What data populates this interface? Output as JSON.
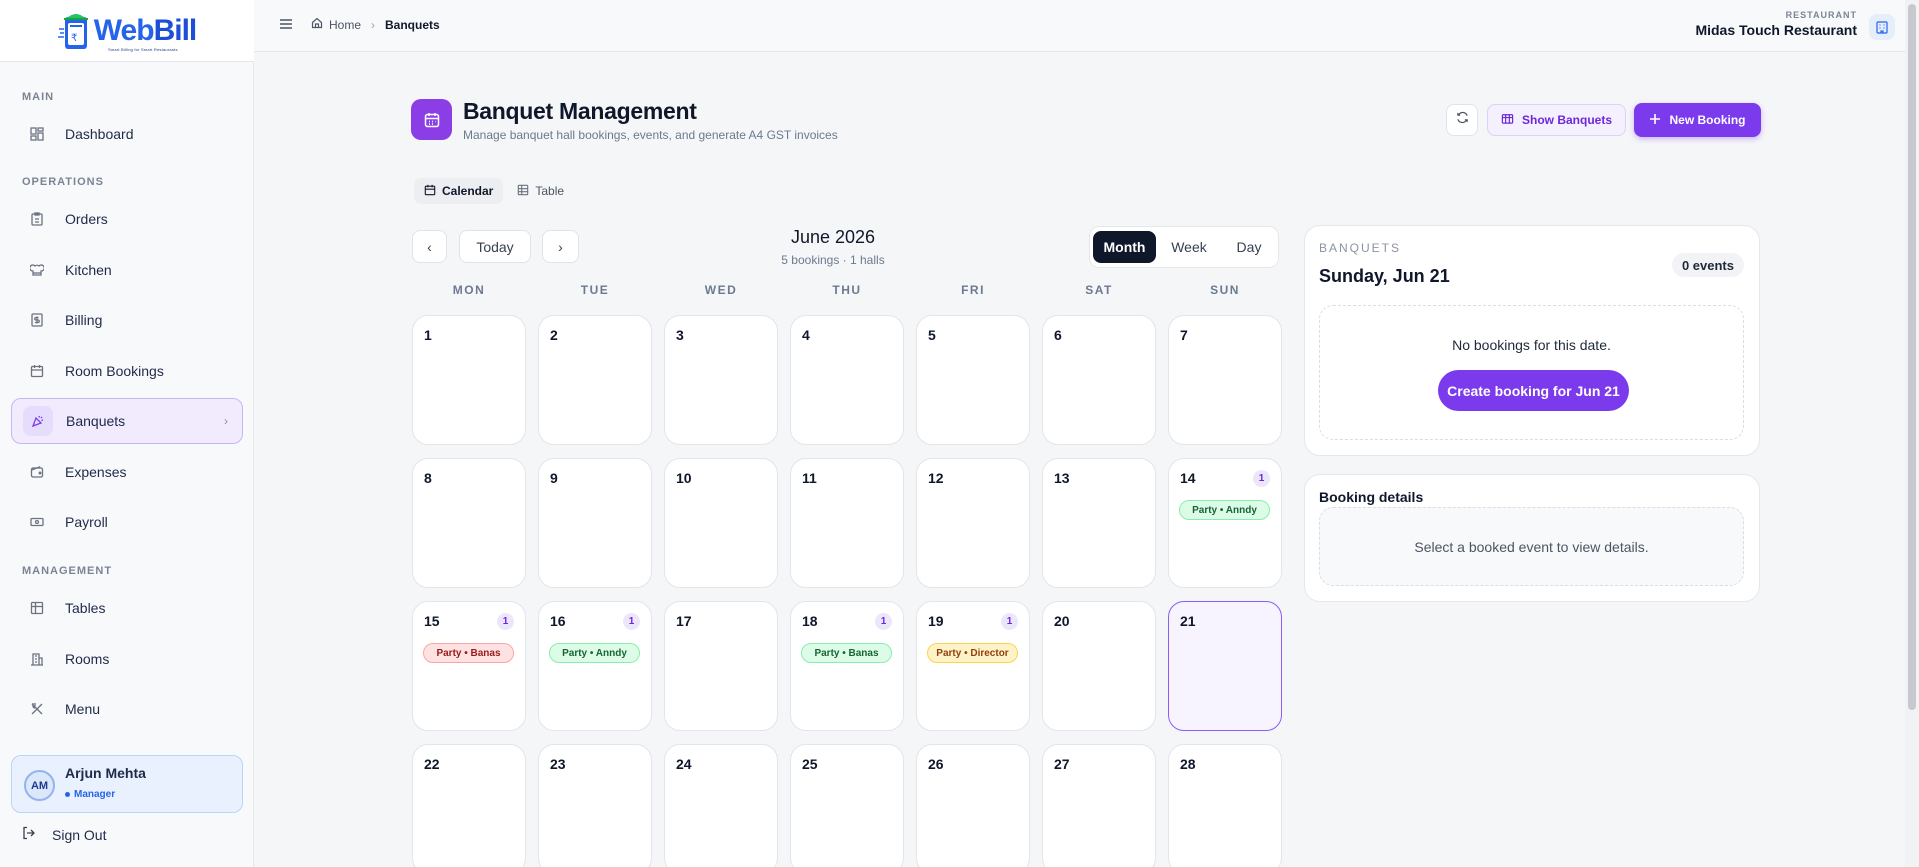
{
  "app": {
    "logo_text_a": "Web",
    "logo_text_b": "Bill",
    "logo_tagline": "Smart Billing for Smart Restaurants"
  },
  "sidebar": {
    "sections": {
      "main": "MAIN",
      "operations": "OPERATIONS",
      "management": "MANAGEMENT"
    },
    "items": [
      {
        "label": "Dashboard",
        "icon": "grid-icon"
      },
      {
        "label": "Orders",
        "icon": "clipboard-icon"
      },
      {
        "label": "Kitchen",
        "icon": "chef-hat-icon"
      },
      {
        "label": "Billing",
        "icon": "receipt-icon"
      },
      {
        "label": "Room Bookings",
        "icon": "calendar-icon"
      },
      {
        "label": "Banquets",
        "icon": "party-popper-icon"
      },
      {
        "label": "Expenses",
        "icon": "wallet-icon"
      },
      {
        "label": "Payroll",
        "icon": "banknote-icon"
      },
      {
        "label": "Tables",
        "icon": "table-icon"
      },
      {
        "label": "Rooms",
        "icon": "building-icon"
      },
      {
        "label": "Menu",
        "icon": "utensils-icon"
      }
    ],
    "user": {
      "initials": "AM",
      "name": "Arjun Mehta",
      "role": "Manager"
    },
    "signout": "Sign Out"
  },
  "topbar": {
    "breadcrumb_home": "Home",
    "breadcrumb_current": "Banquets",
    "restaurant_label": "RESTAURANT",
    "restaurant_name": "Midas Touch Restaurant"
  },
  "header": {
    "title": "Banquet Management",
    "subtitle": "Manage banquet hall bookings, events, and generate A4 GST invoices",
    "show_banquets": "Show Banquets",
    "new_booking": "New Booking"
  },
  "view_tabs": {
    "calendar": "Calendar",
    "table": "Table"
  },
  "calendar": {
    "today_label": "Today",
    "month_title": "June 2026",
    "month_summary": "5 bookings · 1 halls",
    "ranges": [
      "Month",
      "Week",
      "Day"
    ],
    "active_range": "Month",
    "weekdays": [
      "MON",
      "TUE",
      "WED",
      "THU",
      "FRI",
      "SAT",
      "SUN"
    ],
    "selected_day": 21,
    "days": [
      {
        "day": "1"
      },
      {
        "day": "2"
      },
      {
        "day": "3"
      },
      {
        "day": "4"
      },
      {
        "day": "5"
      },
      {
        "day": "6"
      },
      {
        "day": "7"
      },
      {
        "day": "8"
      },
      {
        "day": "9"
      },
      {
        "day": "10"
      },
      {
        "day": "11"
      },
      {
        "day": "12"
      },
      {
        "day": "13"
      },
      {
        "day": "14",
        "count": "1",
        "event": {
          "label": "Party • Anndy",
          "color": "green"
        }
      },
      {
        "day": "15",
        "count": "1",
        "event": {
          "label": "Party • Banas",
          "color": "red"
        }
      },
      {
        "day": "16",
        "count": "1",
        "event": {
          "label": "Party • Anndy",
          "color": "green"
        }
      },
      {
        "day": "17"
      },
      {
        "day": "18",
        "count": "1",
        "event": {
          "label": "Party • Banas",
          "color": "green"
        }
      },
      {
        "day": "19",
        "count": "1",
        "event": {
          "label": "Party • Director",
          "color": "yellow"
        }
      },
      {
        "day": "20"
      },
      {
        "day": "21"
      },
      {
        "day": "22"
      },
      {
        "day": "23"
      },
      {
        "day": "24"
      },
      {
        "day": "25"
      },
      {
        "day": "26"
      },
      {
        "day": "27"
      },
      {
        "day": "28"
      }
    ],
    "event_colors": {
      "green": {
        "bg": "#dcfce7",
        "border": "#86efac",
        "text": "#166534"
      },
      "red": {
        "bg": "#fee2e2",
        "border": "#fca5a5",
        "text": "#991b1b"
      },
      "yellow": {
        "bg": "#fef3c7",
        "border": "#fcd34d",
        "text": "#92400e"
      }
    }
  },
  "side_panel": {
    "label": "BANQUETS",
    "date": "Sunday, Jun 21",
    "events_badge": "0 events",
    "empty_text": "No bookings for this date.",
    "create_button": "Create booking for Jun 21",
    "details_title": "Booking details",
    "details_empty": "Select a booked event to view details."
  },
  "colors": {
    "accent": "#7c3aed",
    "brand_blue": "#2563eb"
  }
}
